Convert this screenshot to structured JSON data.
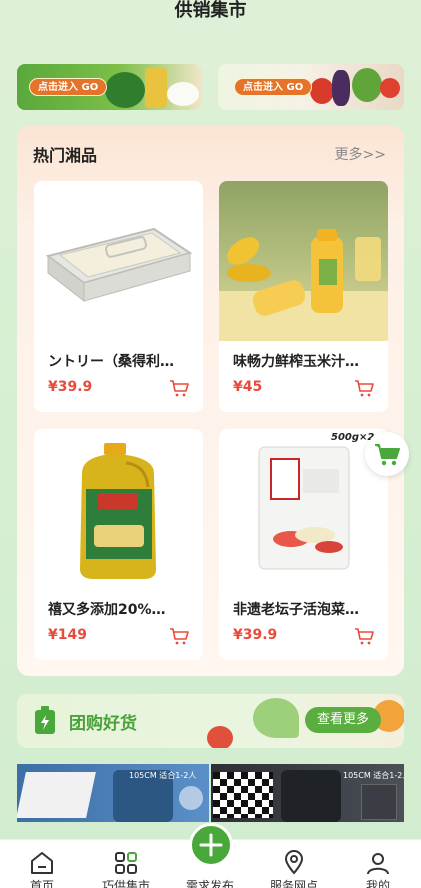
{
  "header": {
    "title": "供销集市"
  },
  "banners": [
    {
      "button_label": "点击进入 GO"
    },
    {
      "button_label": "点击进入 GO"
    }
  ],
  "hot_section": {
    "title": "热门湘品",
    "more_label": "更多>>",
    "products": [
      {
        "name": "ントリー（桑得利…",
        "price": "¥39.9"
      },
      {
        "name": "味畅力鲜榨玉米汁…",
        "price": "¥45"
      },
      {
        "name": "禧又多添加20%…",
        "price": "¥149"
      },
      {
        "name": "非遗老坛子活泡菜…",
        "price": "¥39.9"
      }
    ],
    "pack_label": "500g×2"
  },
  "group_buy": {
    "title": "团购好货",
    "more_label": "查看更多"
  },
  "strips": [
    {
      "top_text": "105CM 适合1-2人"
    },
    {
      "top_text": "105CM 适合1-2人"
    }
  ],
  "bottom_nav": {
    "items": [
      {
        "label": "首页",
        "icon": "home-icon"
      },
      {
        "label": "巧供集市",
        "icon": "grid-icon"
      },
      {
        "label": "需求发布",
        "icon": "plus-icon"
      },
      {
        "label": "服务网点",
        "icon": "location-icon"
      },
      {
        "label": "我的",
        "icon": "user-icon"
      }
    ]
  },
  "colors": {
    "brand_green": "#48a83a",
    "price_red": "#e84b3c",
    "accent_orange": "#e5742a"
  }
}
